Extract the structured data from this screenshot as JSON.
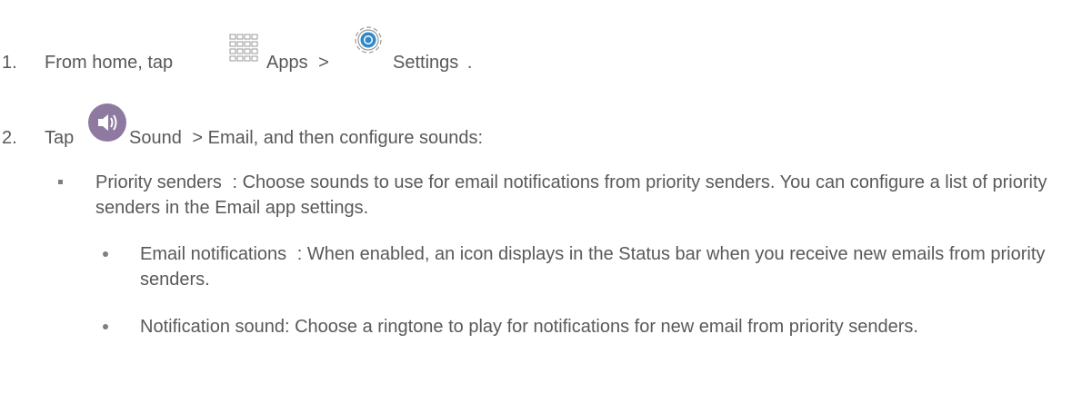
{
  "steps": [
    {
      "number": "1.",
      "text_before": "From home, tap",
      "icon1_name": "apps-grid-icon",
      "icon1_label": "Apps",
      "sep": ">",
      "icon2_name": "settings-gear-icon",
      "icon2_label": "Settings",
      "text_after": "."
    },
    {
      "number": "2.",
      "text_before": "Tap",
      "icon_name": "sound-speaker-icon",
      "label": "Sound",
      "sep": ">",
      "label2": "Email",
      "text_after": ", and then configure sounds:"
    }
  ],
  "bullets": [
    {
      "term": "Priority senders",
      "desc": ": Choose sounds to use for email notifications from priority senders. You can configure a list of priority senders in the Email app settings."
    }
  ],
  "subbullets": [
    {
      "term": "Email notifications",
      "desc": ": When enabled, an icon displays in the Status bar when you receive new emails from priority senders."
    },
    {
      "term": "Notification sound:",
      "desc": "Choose a ringtone to play for notifications for new email from priority senders."
    }
  ],
  "colors": {
    "text": "#595959",
    "speaker_icon": "#8e7aa0",
    "gear_icon": "#2f88c9"
  }
}
